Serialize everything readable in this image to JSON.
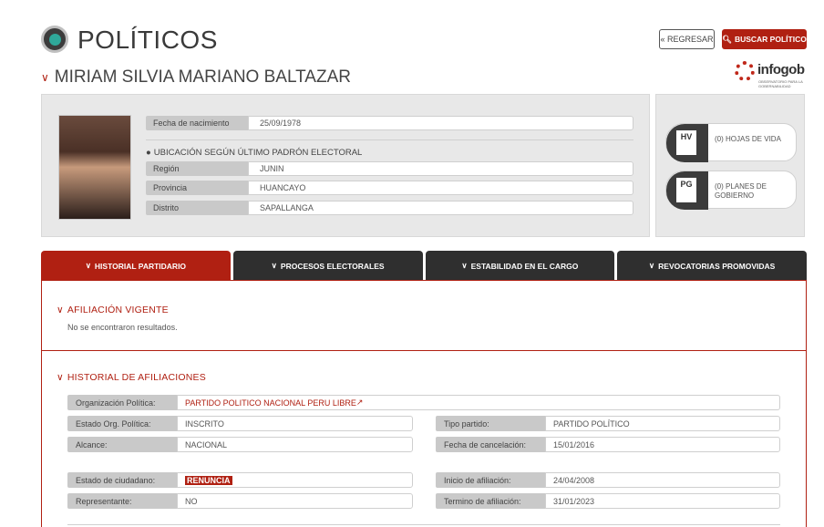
{
  "header": {
    "title": "POLÍTICOS",
    "back_label": "« REGRESAR",
    "search_label": "BUSCAR POLÍTICO",
    "logo_word": "infogob",
    "logo_tagline": "OBSERVATORIO PARA LA GOBERNABILIDAD"
  },
  "person": {
    "name": "MIRIAM SILVIA MARIANO BALTAZAR",
    "birth_label": "Fecha de nacimiento",
    "birth_value": "25/09/1978",
    "ubication_title": "UBICACIÓN SEGÚN ÚLTIMO PADRÓN ELECTORAL",
    "region_label": "Región",
    "region_value": "JUNIN",
    "provincia_label": "Provincia",
    "provincia_value": "HUANCAYO",
    "distrito_label": "Distrito",
    "distrito_value": "SAPALLANGA"
  },
  "side": {
    "hv_icon": "HV",
    "hv_text": "(0) HOJAS DE VIDA",
    "pg_icon": "PG",
    "pg_text": "(0) PLANES DE GOBIERNO"
  },
  "tabs": [
    {
      "label": "HISTORIAL PARTIDARIO"
    },
    {
      "label": "PROCESOS ELECTORALES"
    },
    {
      "label": "ESTABILIDAD EN EL CARGO"
    },
    {
      "label": "REVOCATORIAS PROMOVIDAS"
    }
  ],
  "afiliacion_vigente": {
    "title": "AFILIACIÓN VIGENTE",
    "empty": "No se encontraron resultados."
  },
  "historial": {
    "title": "HISTORIAL DE AFILIACIONES",
    "org_label": "Organización Política:",
    "org_value": "PARTIDO POLITICO NACIONAL PERU LIBRE",
    "estado_org_label": "Estado Org. Política:",
    "estado_org_value": "INSCRITO",
    "tipo_label": "Tipo partido:",
    "tipo_value": "PARTIDO POLÍTICO",
    "alcance_label": "Alcance:",
    "alcance_value": "NACIONAL",
    "cancel_label": "Fecha de cancelación:",
    "cancel_value": "15/01/2016",
    "ciudadano_label": "Estado de ciudadano:",
    "ciudadano_value": "RENUNCIA",
    "inicio_label": "Inicio de afiliación:",
    "inicio_value": "24/04/2008",
    "repre_label": "Representante:",
    "repre_value": "NO",
    "termino_label": "Termino de afiliación:",
    "termino_value": "31/01/2023"
  },
  "colors": {
    "accent": "#b02012",
    "dark": "#2f2f2f"
  }
}
